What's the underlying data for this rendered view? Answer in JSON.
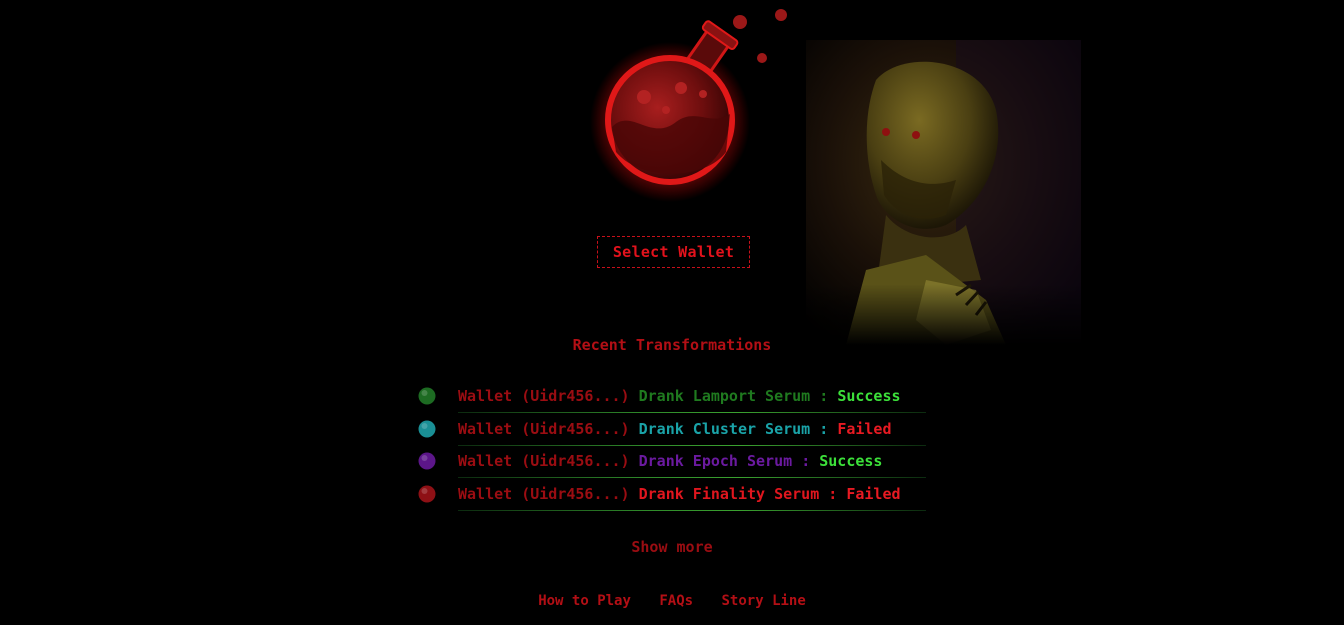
{
  "hero": {
    "flask_icon": "red-potion-flask-icon",
    "portrait_icon": "ghoul-portrait-image"
  },
  "select_wallet_label": "Select Wallet",
  "recent": {
    "title": "Recent Transformations",
    "items": [
      {
        "wallet": "Wallet (Uidr456...)",
        "action": "Drank Lamport Serum",
        "separator": ":",
        "status": "Success",
        "action_color": "#1f7a1f",
        "status_color": "#3ce03a",
        "orb_color": "#1d6b22",
        "orb_icon": "green-orb-icon"
      },
      {
        "wallet": "Wallet (Uidr456...)",
        "action": "Drank Cluster Serum",
        "separator": ":",
        "status": "Failed",
        "action_color": "#1aa3a8",
        "status_color": "#e81a22",
        "orb_color": "#1a8f95",
        "orb_icon": "teal-orb-icon"
      },
      {
        "wallet": "Wallet (Uidr456...)",
        "action": "Drank Epoch Serum",
        "separator": ":",
        "status": "Success",
        "action_color": "#6b1aa0",
        "status_color": "#3ce03a",
        "orb_color": "#5c1689",
        "orb_icon": "purple-orb-icon"
      },
      {
        "wallet": "Wallet (Uidr456...)",
        "action": "Drank Finality Serum",
        "separator": ":",
        "status": "Failed",
        "action_color": "#e0161e",
        "status_color": "#e81a22",
        "orb_color": "#8e1015",
        "orb_icon": "red-orb-icon"
      }
    ]
  },
  "show_more_label": "Show more",
  "footer": {
    "links": [
      "How to Play",
      "FAQs",
      "Story Line"
    ]
  },
  "colors": {
    "background": "#000000",
    "accent_red": "#e2121c",
    "success_green": "#3ce03a"
  }
}
